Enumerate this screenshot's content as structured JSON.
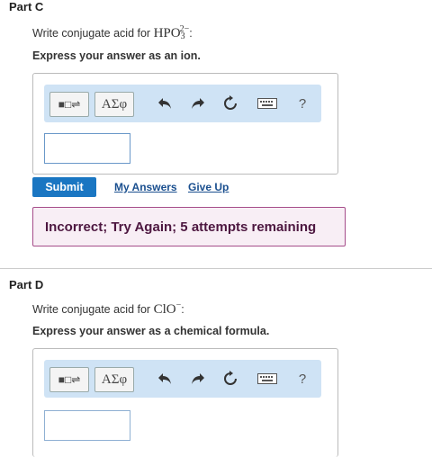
{
  "partC": {
    "title": "Part C",
    "prompt_text": "Write conjugate acid for",
    "formula_base": "HPO",
    "formula_sub": "3",
    "formula_charge": "2−",
    "colon": ":",
    "instruction": "Express your answer as an ion.",
    "toolbar": {
      "template_label": "■□⇌",
      "greek_label": "ΑΣφ",
      "help_label": "?"
    },
    "answer_value": "",
    "submit_label": "Submit",
    "my_answers_label": "My Answers",
    "give_up_label": "Give Up",
    "feedback": "Incorrect; Try Again; 5 attempts remaining"
  },
  "partD": {
    "title": "Part D",
    "prompt_text": "Write conjugate acid for",
    "formula_base": "ClO",
    "formula_charge": "−",
    "colon": ":",
    "instruction": "Express your answer as a chemical formula.",
    "toolbar": {
      "template_label": "■□⇌",
      "greek_label": "ΑΣφ",
      "help_label": "?"
    },
    "answer_value": ""
  },
  "colors": {
    "submit": "#1a76c2",
    "toolbar_bg": "#cfe3f5",
    "feedback_border": "#a64d8a",
    "feedback_bg": "#f8eef5",
    "link": "#1a4f8f"
  }
}
